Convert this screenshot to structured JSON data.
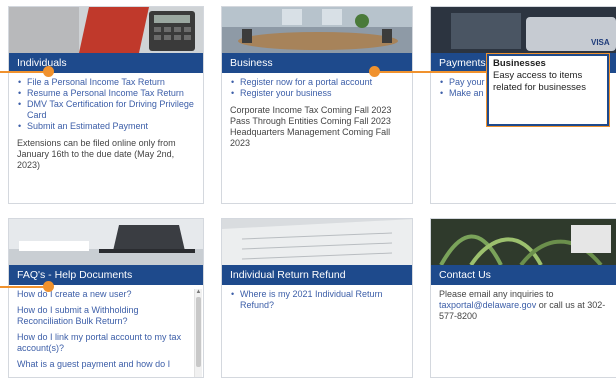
{
  "individuals": {
    "title": "Individuals",
    "links": [
      "File a Personal Income Tax Return",
      "Resume a Personal Income Tax Return",
      "DMV Tax Certification for Driving Privilege Card",
      "Submit an Estimated Payment"
    ],
    "note": "Extensions can be filed online only from January 16th to the due date (May 2nd, 2023)"
  },
  "business": {
    "title": "Business",
    "links": [
      "Register now for a portal account",
      "Register your business"
    ],
    "note_lines": [
      "Corporate Income Tax Coming Fall 2023",
      "Pass Through Entities Coming Fall 2023",
      "Headquarters Management Coming Fall 2023"
    ]
  },
  "payments": {
    "title": "Payments",
    "links": [
      "Pay your",
      "Make an"
    ]
  },
  "tooltip": {
    "title": "Businesses",
    "text": "Easy access to items related for businesses"
  },
  "faq": {
    "title": "FAQ's - Help Documents",
    "questions": [
      "How do I create a new user?",
      "How do I submit a Withholding Reconciliation Bulk Return?",
      "How do I link my portal account to my tax account(s)?",
      "What is a guest payment and how do I"
    ]
  },
  "refund": {
    "title": "Individual Return Refund",
    "links": [
      "Where is my 2021 Individual Return Refund?"
    ]
  },
  "contact": {
    "title": "Contact Us",
    "text_before": "Please email any inquiries to ",
    "email": "taxportal@delaware.gov",
    "text_after": " or call us at 302-577-8200"
  },
  "colors": {
    "header_bar": "#1e4a8c",
    "link": "#3c5ea8",
    "callout": "#f0922e"
  }
}
